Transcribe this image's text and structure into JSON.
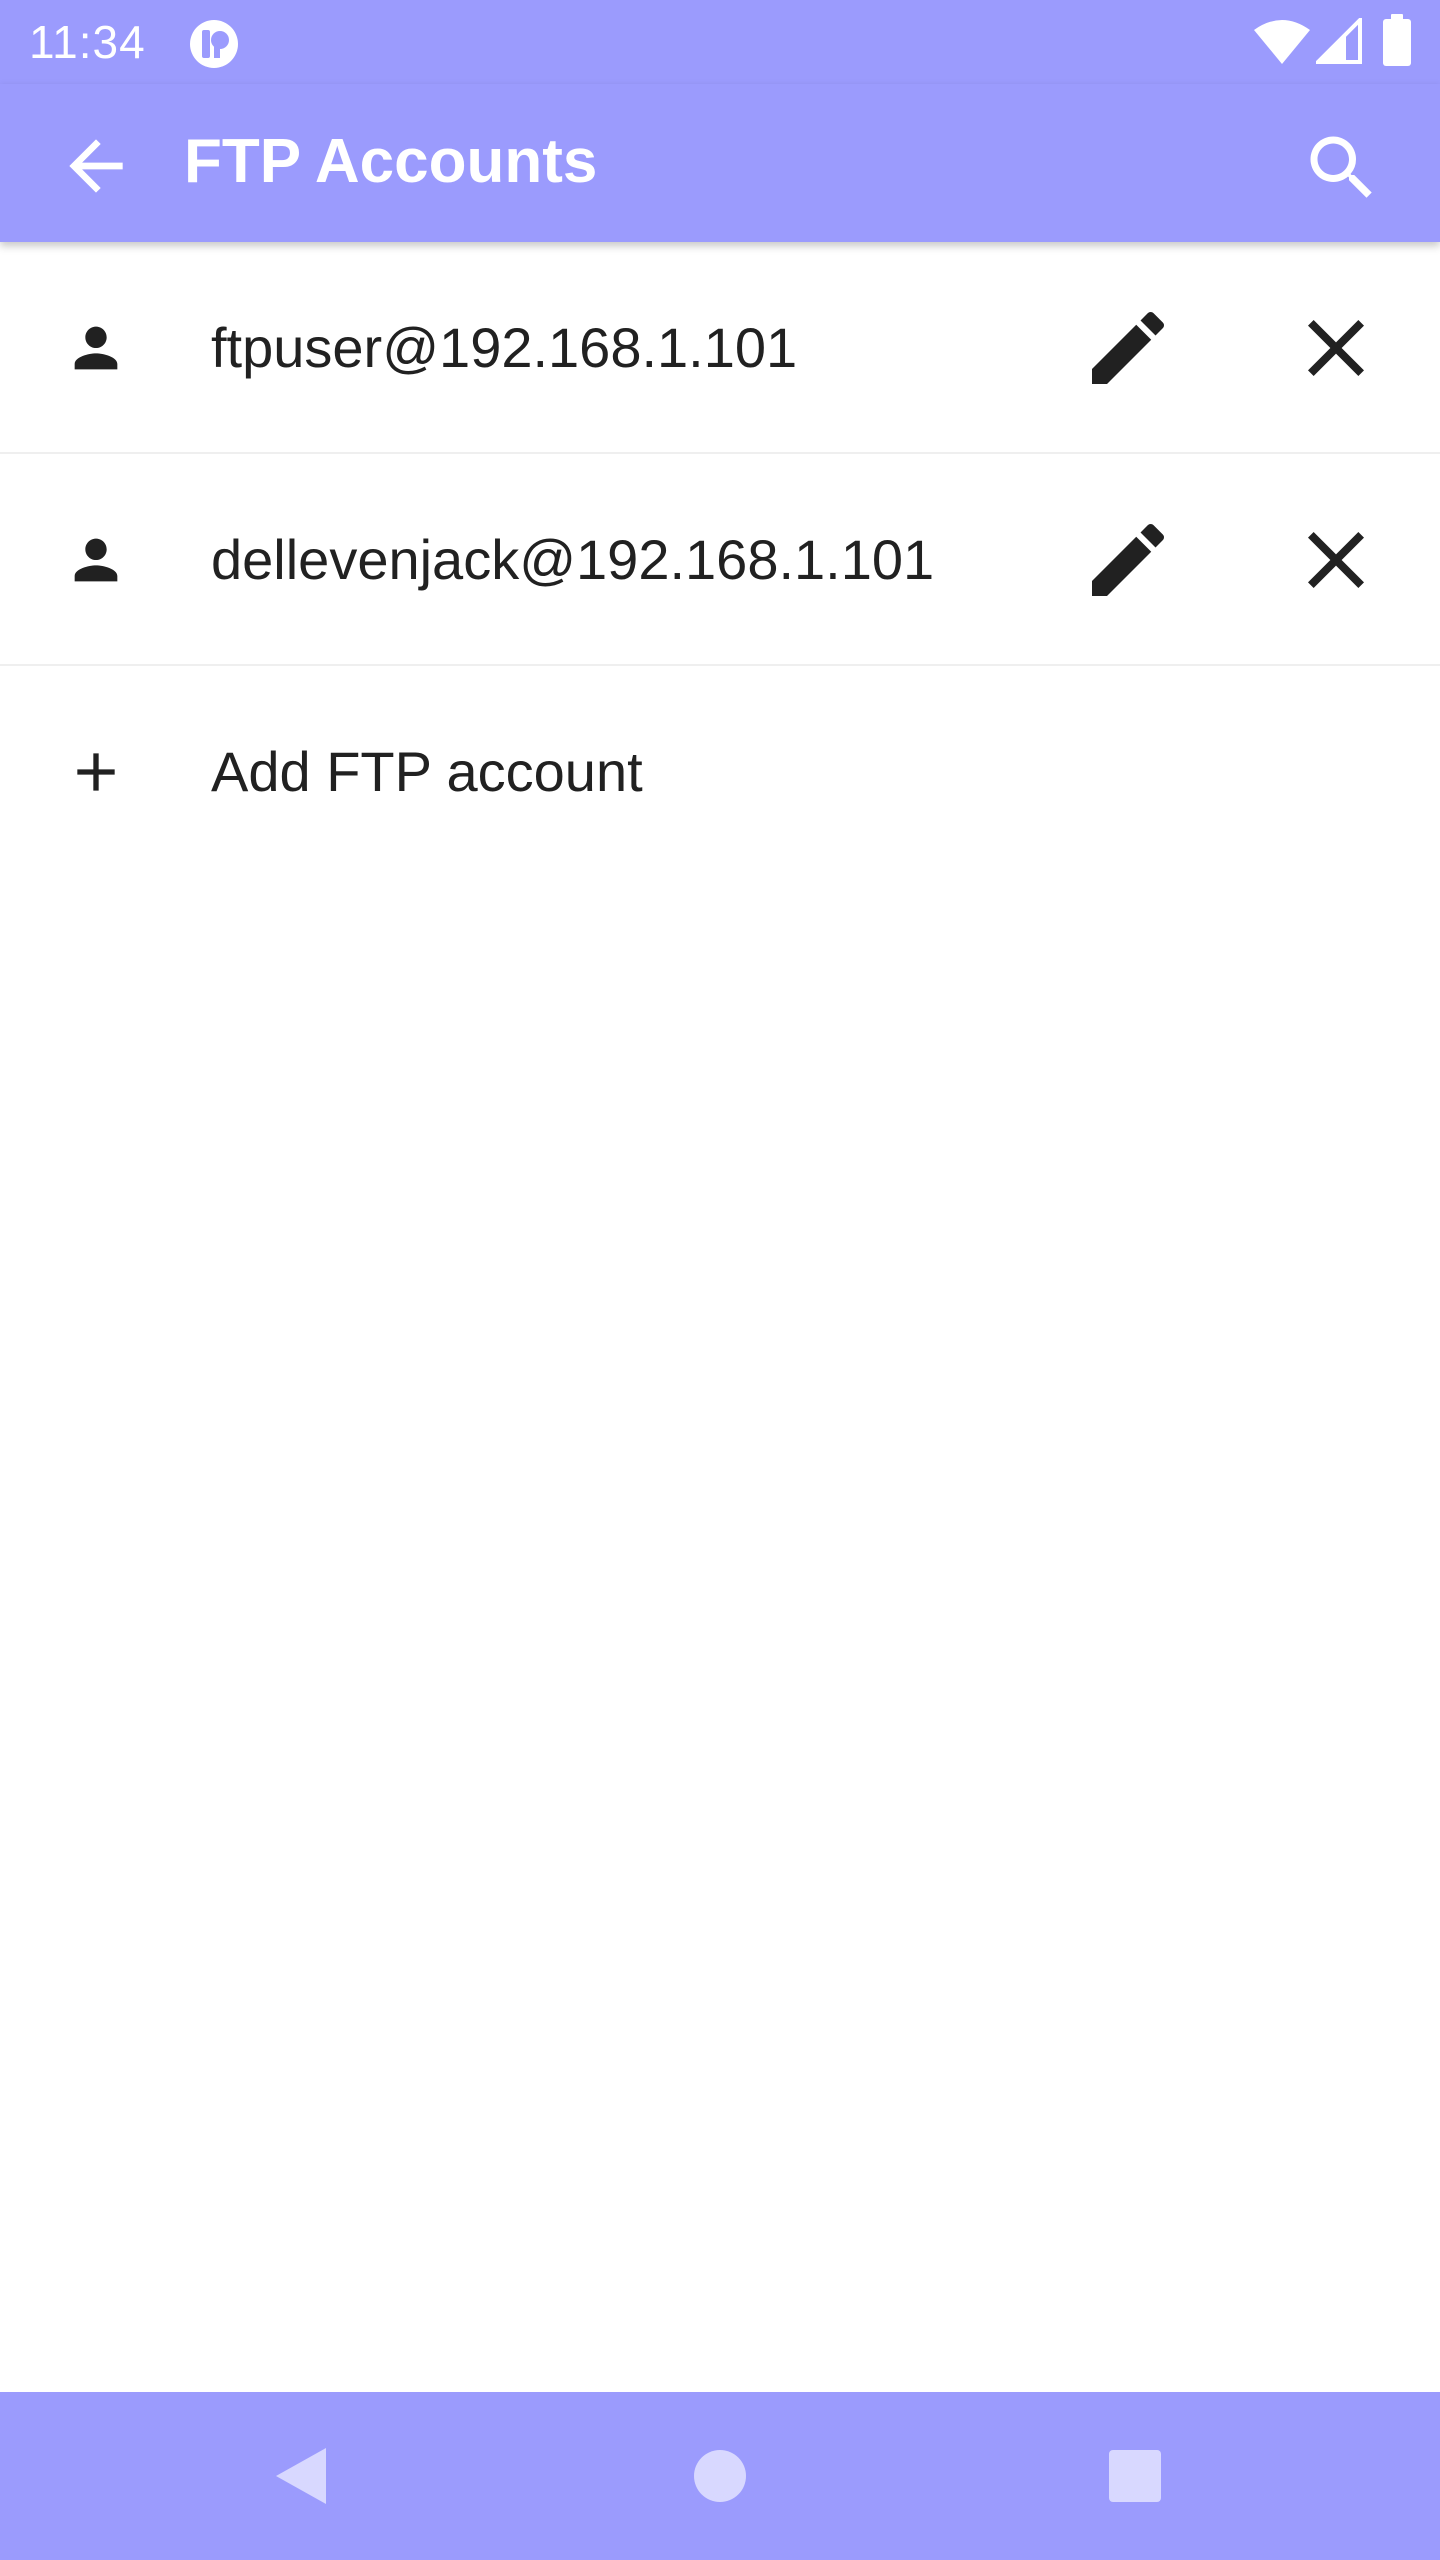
{
  "status_bar": {
    "time": "11:34",
    "icons": [
      "notification-app-icon",
      "wifi-icon",
      "signal-icon",
      "battery-icon"
    ]
  },
  "app_bar": {
    "title": "FTP Accounts",
    "back_icon": "arrow-back-icon",
    "search_icon": "search-icon"
  },
  "accounts": [
    {
      "label": "ftpuser@192.168.1.101",
      "icon": "person-icon"
    },
    {
      "label": "dellevenjack@192.168.1.101",
      "icon": "person-icon"
    }
  ],
  "add_account": {
    "label": "Add FTP account",
    "icon": "plus-icon"
  },
  "nav_bar": {
    "buttons": [
      "back-triangle-icon",
      "home-circle-icon",
      "recents-square-icon"
    ]
  },
  "colors": {
    "primary": "#9b9bfd",
    "text": "#212121",
    "icon": "#212121",
    "divider": "#efefef"
  }
}
